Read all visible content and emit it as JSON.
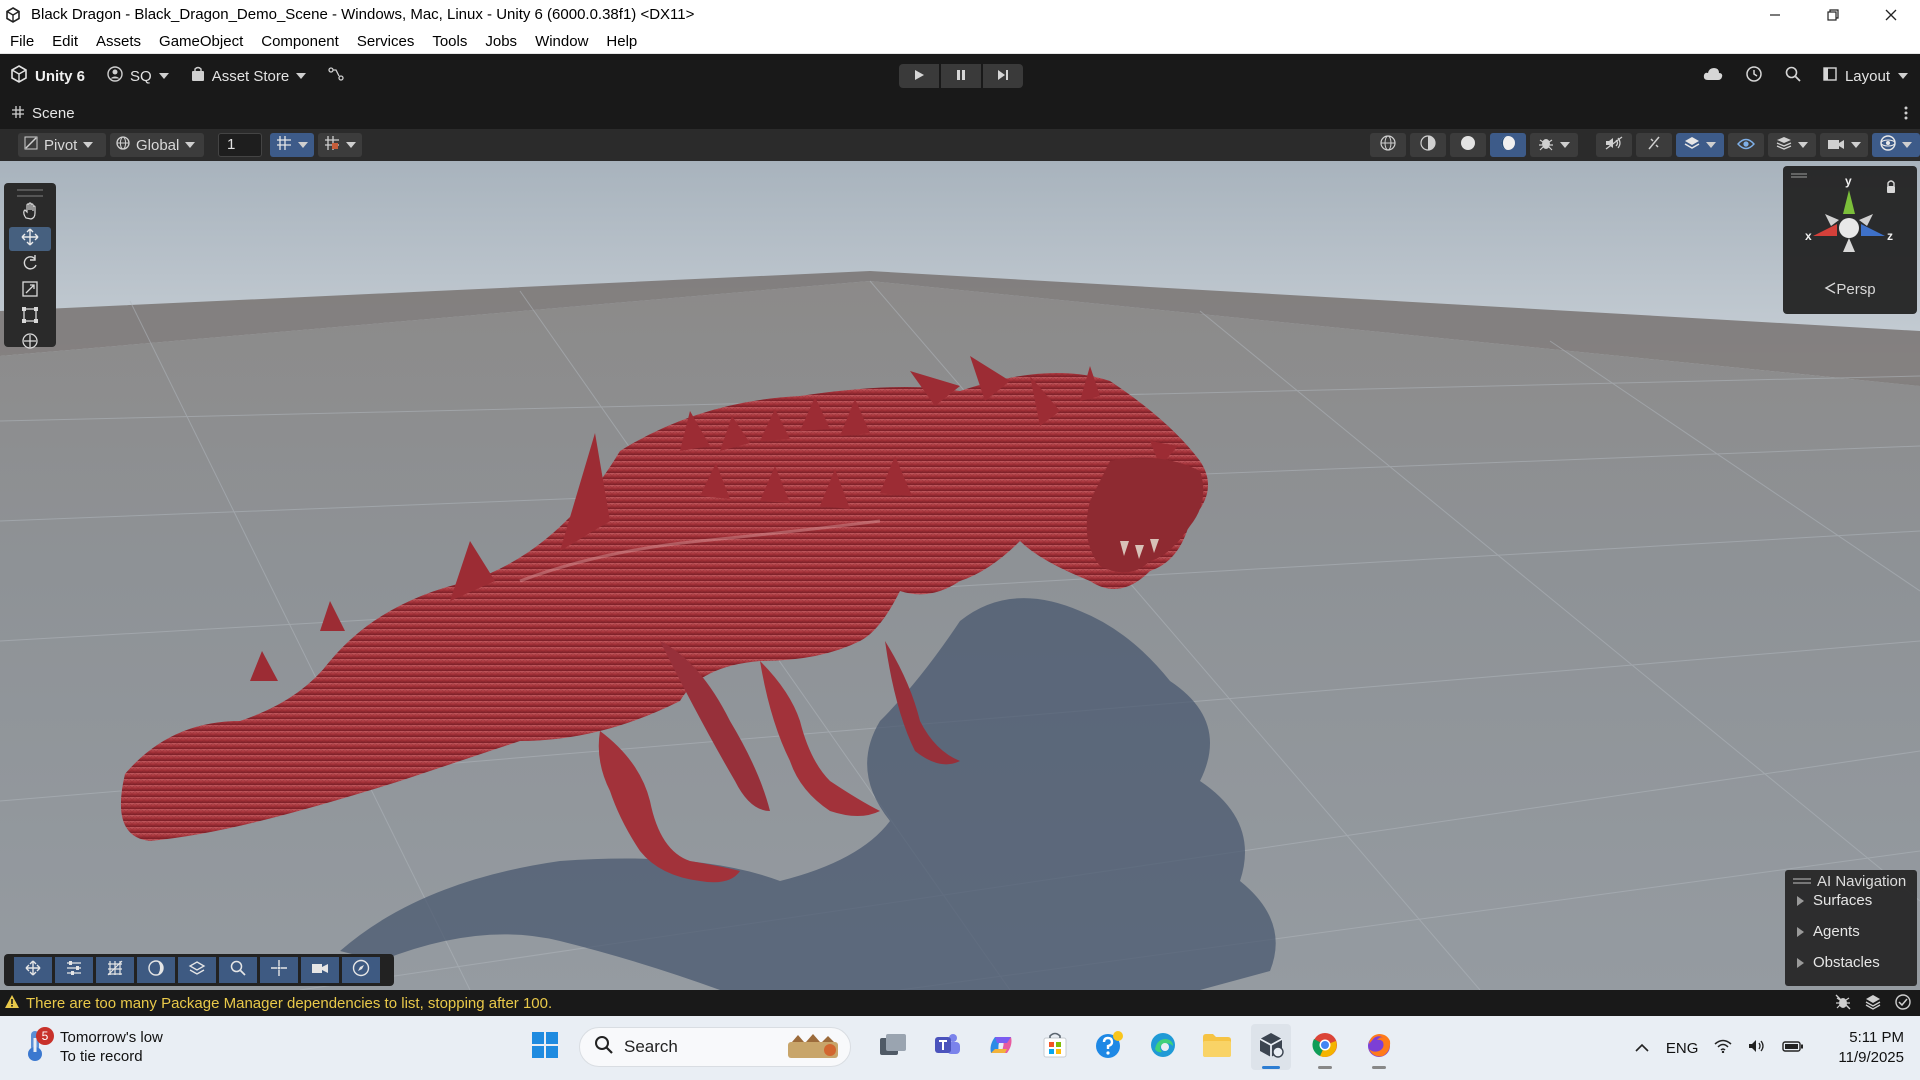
{
  "window": {
    "title": "Black Dragon - Black_Dragon_Demo_Scene - Windows, Mac, Linux - Unity 6 (6000.0.38f1) <DX11>",
    "controls": [
      "minimize",
      "restore",
      "close"
    ]
  },
  "menu": {
    "items": [
      "File",
      "Edit",
      "Assets",
      "GameObject",
      "Component",
      "Services",
      "Tools",
      "Jobs",
      "Window",
      "Help"
    ]
  },
  "toolbar": {
    "brand": "Unity 6",
    "account": "SQ",
    "asset_store": "Asset Store",
    "layout": "Layout"
  },
  "scene": {
    "tab_label": "Scene",
    "pivot": "Pivot",
    "global": "Global",
    "grid_value": "1",
    "persp": "Persp",
    "axes": {
      "y": "y",
      "x": "x",
      "z": "z"
    }
  },
  "ai_navigation": {
    "title": "AI Navigation",
    "items": [
      "Surfaces",
      "Agents",
      "Obstacles"
    ]
  },
  "status": {
    "message": "There are too many Package Manager dependencies to list, stopping after 100."
  },
  "taskbar": {
    "weather_title": "Tomorrow's low",
    "weather_sub": "To tie record",
    "weather_badge": "5",
    "search": "Search",
    "lang": "ENG",
    "time": "5:11 PM",
    "date": "11/9/2025"
  },
  "colors": {
    "accent_blue": "#3d5b89",
    "warning_yellow": "#e9c94a",
    "dragon_red": "#a8333a"
  }
}
